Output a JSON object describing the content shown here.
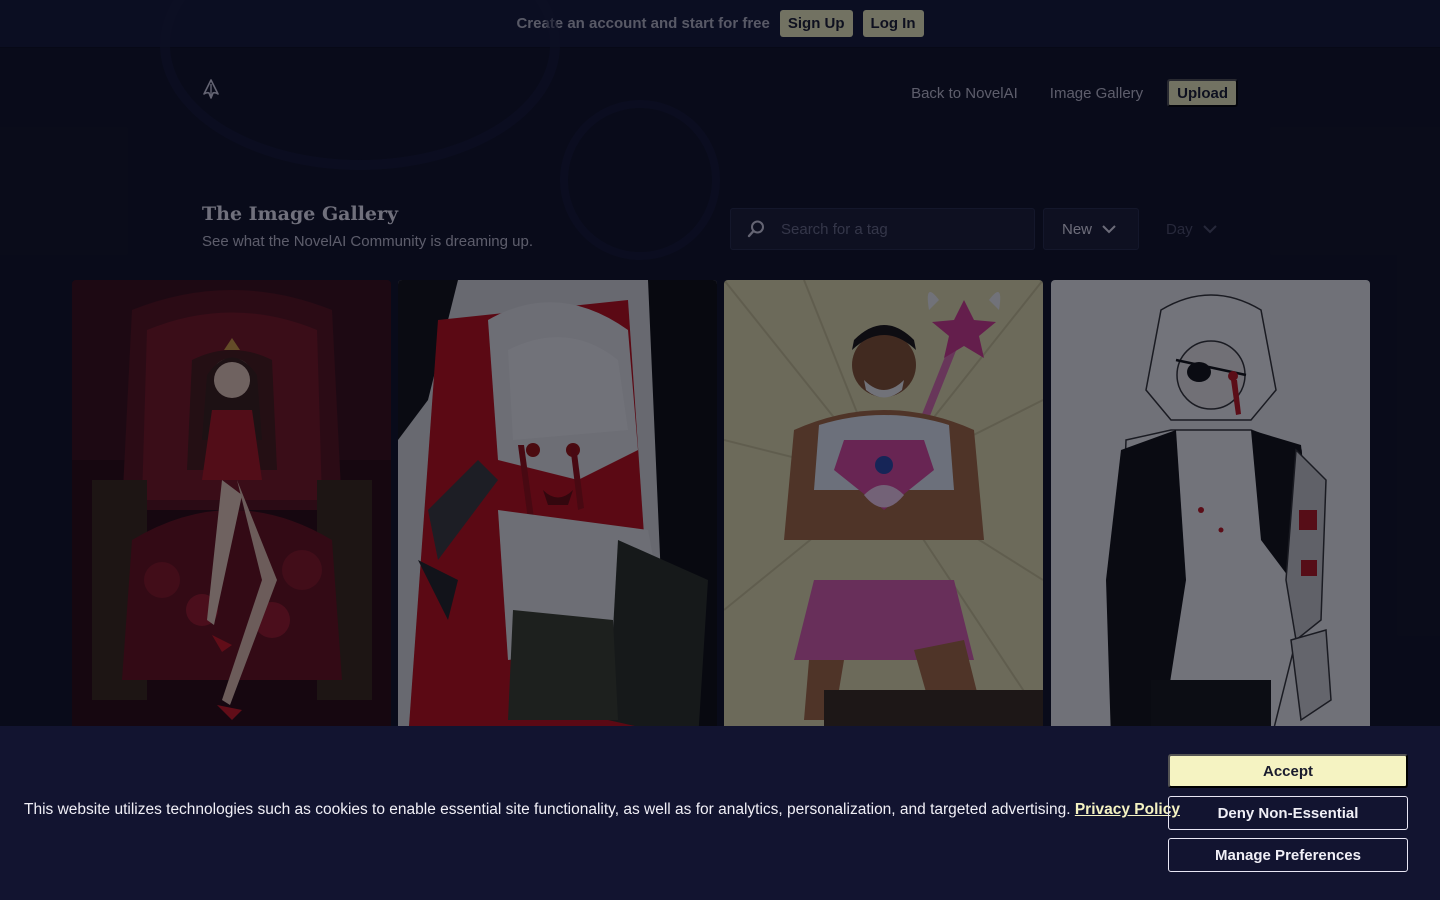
{
  "banner": {
    "text": "Create an account and start for free",
    "signup_label": "Sign Up",
    "login_label": "Log In"
  },
  "header": {
    "logo_icon": "novelai-logo-icon",
    "nav": {
      "back_label": "Back to NovelAI",
      "gallery_label": "Image Gallery",
      "upload_label": "Upload"
    }
  },
  "gallery_header": {
    "title": "The Image Gallery",
    "subtitle": "See what the NovelAI Community is dreaming up."
  },
  "search": {
    "placeholder": "Search for a tag",
    "icon": "search-icon"
  },
  "filters": {
    "sort_value": "New",
    "period_value": "Day"
  },
  "gallery": {
    "images": [
      {
        "theme": "red-throne-queen",
        "bg": "#3a0d12"
      },
      {
        "theme": "manga-red-card",
        "bg": "#d9d9d9"
      },
      {
        "theme": "magical-muscle-man",
        "bg": "#e8e2b0"
      },
      {
        "theme": "cyborg-eyepatch-girl",
        "bg": "#f2f2f2"
      }
    ]
  },
  "cookie": {
    "text": "This website utilizes technologies such as cookies to enable essential site functionality, as well as for analytics, personalization, and targeted advertising.",
    "privacy_label": "Privacy Policy",
    "accept_label": "Accept",
    "deny_label": "Deny Non-Essential",
    "prefs_label": "Manage Preferences"
  },
  "colors": {
    "background": "#0e1022",
    "accent": "#f5f3c2",
    "banner": "#131733",
    "cookie_bar": "#121430"
  }
}
